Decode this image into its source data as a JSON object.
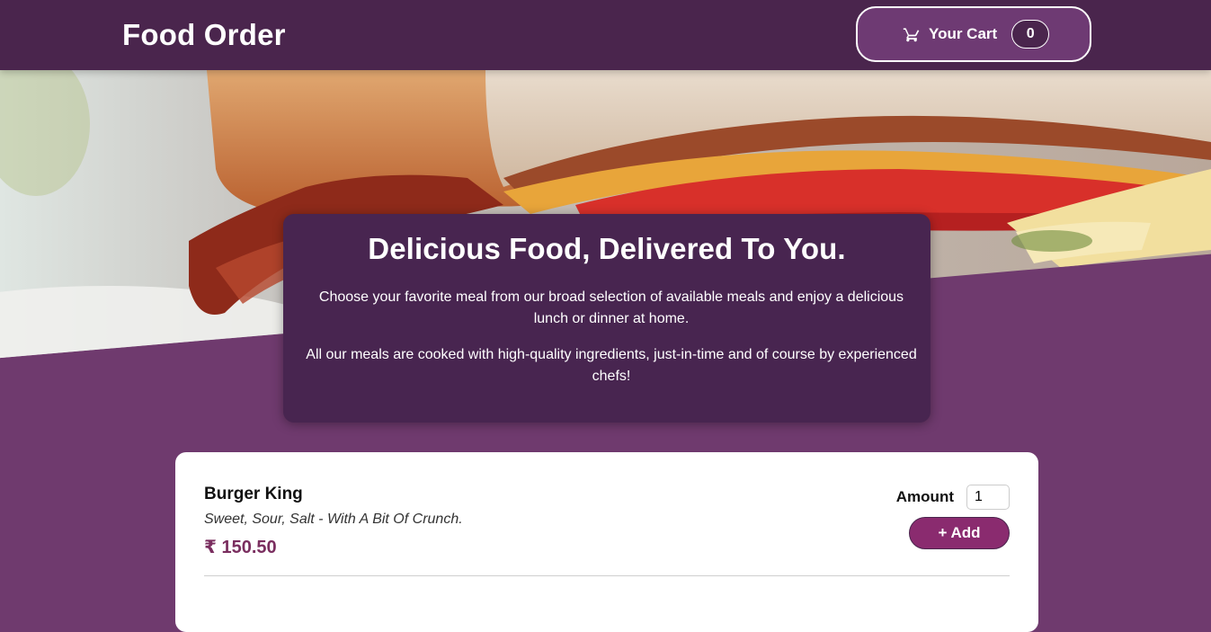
{
  "header": {
    "title": "Food Order",
    "cart_label": "Your Cart",
    "cart_count": "0",
    "cart_icon": "cart-icon"
  },
  "hero": {
    "image": "sandwich-photo"
  },
  "summary": {
    "heading": "Delicious Food, Delivered To You.",
    "paragraph1": "Choose your favorite meal from our broad selection of available meals and enjoy a delicious lunch or dinner at home.",
    "paragraph2": "All our meals are cooked with high-quality ingredients, just-in-time and of course by experienced chefs!"
  },
  "meals": [
    {
      "name": "Burger King",
      "description": "Sweet, Sour, Salt - With A Bit Of Crunch.",
      "price": "₹ 150.50",
      "amount_label": "Amount",
      "amount_value": "1",
      "add_label": "+ Add"
    }
  ],
  "colors": {
    "header_bg": "#4a254d",
    "page_bg": "#6f3a6e",
    "accent": "#8a2b6f",
    "price": "#7a2e5f"
  }
}
